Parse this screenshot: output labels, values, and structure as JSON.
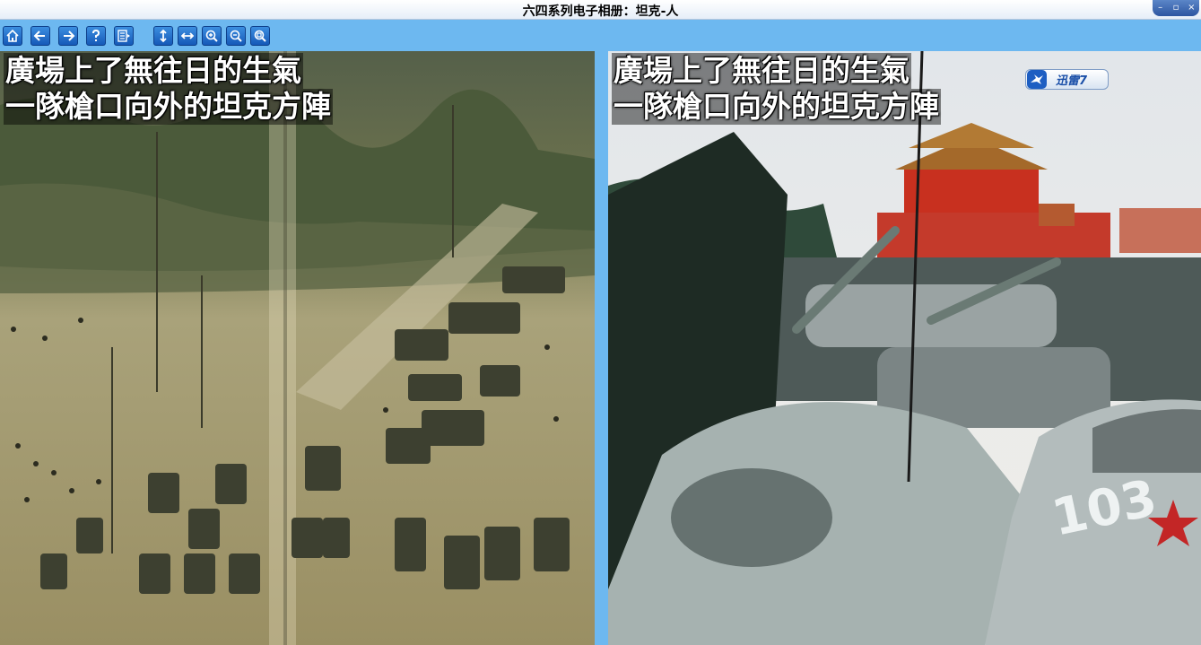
{
  "window": {
    "title": "六四系列电子相册：坦克-人",
    "controls": {
      "minimize": "–",
      "restore": "▫",
      "close": "×"
    }
  },
  "toolbar": {
    "buttons": [
      {
        "name": "home",
        "icon": "home-icon"
      },
      {
        "name": "back",
        "icon": "arrow-left-icon"
      },
      {
        "name": "forward",
        "icon": "arrow-right-icon"
      },
      {
        "name": "help",
        "icon": "question-icon"
      },
      {
        "name": "contents",
        "icon": "page-list-icon"
      },
      {
        "name": "fit-height",
        "icon": "vertical-arrows-icon"
      },
      {
        "name": "fit-width",
        "icon": "horizontal-arrows-icon"
      },
      {
        "name": "zoom-in",
        "icon": "zoom-in-icon"
      },
      {
        "name": "zoom-out",
        "icon": "zoom-out-icon"
      },
      {
        "name": "zoom-actual",
        "icon": "zoom-fit-icon"
      }
    ]
  },
  "pages": {
    "left": {
      "caption_line1": "廣場上了無往日的生氣",
      "caption_line2": "一隊槍口向外的坦克方陣"
    },
    "right": {
      "caption_line1": "廣場上了無往日的生氣",
      "caption_line2": "一隊槍口向外的坦克方陣",
      "tank_number": "103"
    }
  },
  "overlay": {
    "xunlei_label": "迅雷7"
  }
}
